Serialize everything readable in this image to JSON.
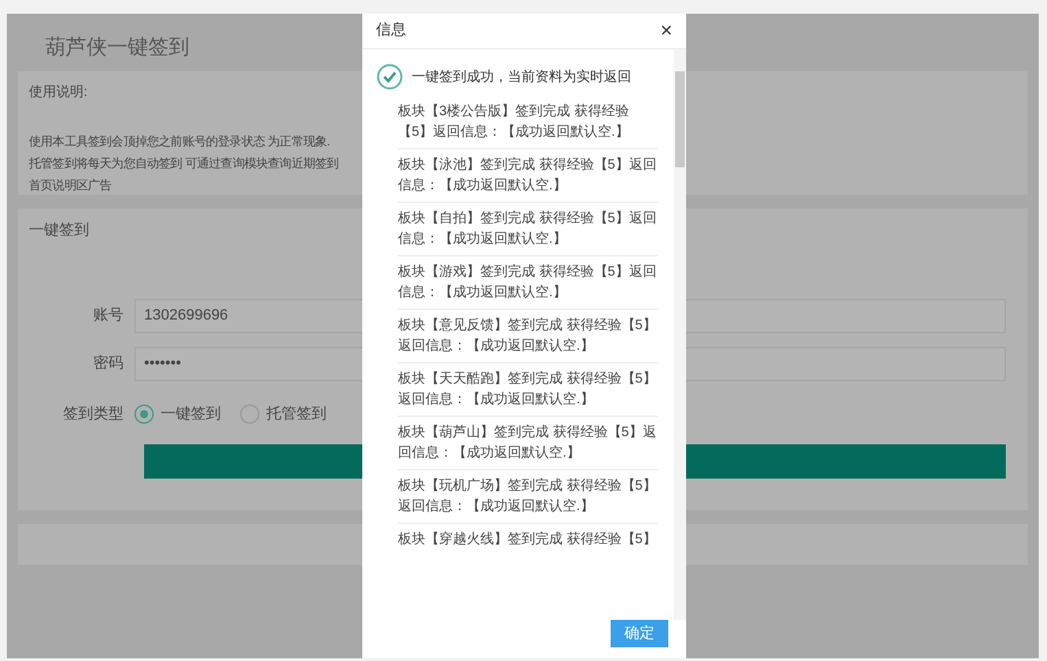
{
  "page": {
    "title": "葫芦侠一键签到",
    "instructions": {
      "heading": "使用说明:",
      "lines": [
        "使用本工具签到会顶掉您之前账号的登录状态 为正常现象.",
        "托管签到将每天为您自动签到 可通过查询模块查询近期签到",
        "首页说明区广告"
      ]
    },
    "form": {
      "heading": "一键签到",
      "fields": [
        {
          "label": "账号",
          "value": "1302699696"
        },
        {
          "label": "密码",
          "value": "•••••••"
        }
      ],
      "type_label": "签到类型",
      "options": [
        {
          "label": "一键签到",
          "selected": true
        },
        {
          "label": "托管签到",
          "selected": false
        }
      ]
    }
  },
  "dialog": {
    "title": "信息",
    "close": "×",
    "success": "一键签到成功，当前资料为实时返回",
    "items": [
      "板块【3楼公告版】签到完成 获得经验【5】返回信息：【成功返回默认空.】",
      "板块【泳池】签到完成 获得经验【5】返回信息：【成功返回默认空.】",
      "板块【自拍】签到完成 获得经验【5】返回信息：【成功返回默认空.】",
      "板块【游戏】签到完成 获得经验【5】返回信息：【成功返回默认空.】",
      "板块【意见反馈】签到完成 获得经验【5】返回信息：【成功返回默认空.】",
      "板块【天天酷跑】签到完成 获得经验【5】返回信息：【成功返回默认空.】",
      "板块【葫芦山】签到完成 获得经验【5】返回信息：【成功返回默认空.】",
      "板块【玩机广场】签到完成 获得经验【5】返回信息：【成功返回默认空.】",
      "板块【穿越火线】签到完成 获得经验【5】"
    ],
    "confirm": "确定"
  }
}
